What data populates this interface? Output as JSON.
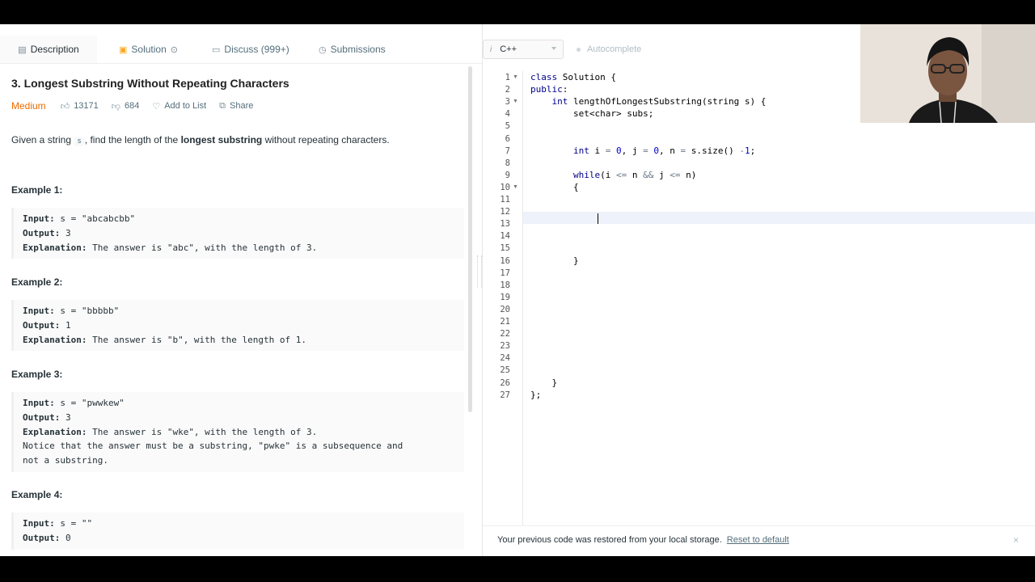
{
  "tabs": [
    {
      "label": "Description",
      "icon": "description-icon"
    },
    {
      "label": "Solution",
      "icon": "lock-icon"
    },
    {
      "label": "Discuss (999+)",
      "icon": "chat-icon"
    },
    {
      "label": "Submissions",
      "icon": "clock-icon"
    }
  ],
  "problem": {
    "title": "3. Longest Substring Without Repeating Characters",
    "difficulty": "Medium",
    "likes": "13171",
    "dislikes": "684",
    "add_to_list": "Add to List",
    "share": "Share",
    "statement_pre": "Given a string ",
    "statement_code": "s",
    "statement_mid": ", find the length of the ",
    "statement_bold": "longest substring",
    "statement_post": " without repeating characters."
  },
  "examples": [
    {
      "title": "Example 1:",
      "input_label": "Input:",
      "input": " s = \"abcabcbb\"",
      "output_label": "Output:",
      "output": " 3",
      "explanation_label": "Explanation:",
      "explanation": " The answer is \"abc\", with the length of 3."
    },
    {
      "title": "Example 2:",
      "input_label": "Input:",
      "input": " s = \"bbbbb\"",
      "output_label": "Output:",
      "output": " 1",
      "explanation_label": "Explanation:",
      "explanation": " The answer is \"b\", with the length of 1."
    },
    {
      "title": "Example 3:",
      "input_label": "Input:",
      "input": " s = \"pwwkew\"",
      "output_label": "Output:",
      "output": " 3",
      "explanation_label": "Explanation:",
      "explanation": " The answer is \"wke\", with the length of 3.",
      "note1": "Notice that the answer must be a substring, \"pwke\" is a subsequence and",
      "note2": "not a substring."
    },
    {
      "title": "Example 4:",
      "input_label": "Input:",
      "input": " s = \"\"",
      "output_label": "Output:",
      "output": " 0"
    }
  ],
  "editor": {
    "language": "C++",
    "language_info": "i",
    "autocomplete": "Autocomplete",
    "line_numbers": [
      "1",
      "2",
      "3",
      "4",
      "5",
      "6",
      "7",
      "8",
      "9",
      "10",
      "11",
      "12",
      "13",
      "14",
      "15",
      "16",
      "17",
      "18",
      "19",
      "20",
      "21",
      "22",
      "23",
      "24",
      "25",
      "26",
      "27"
    ],
    "code": {
      "l1_kw": "class",
      "l1_rest": " Solution {",
      "l2_kw": "public",
      "l2_rest": ":",
      "l3_ind": "    ",
      "l3_kw": "int",
      "l3_rest": " lengthOfLongestSubstring(string s) {",
      "l4": "        set<char> subs;",
      "l7_ind": "        ",
      "l7_kw": "int",
      "l7_a": " i ",
      "l7_eq1": "=",
      "l7_n0": " 0",
      "l7_b": ", j ",
      "l7_eq2": "=",
      "l7_n1": " 0",
      "l7_c": ", n ",
      "l7_eq3": "=",
      "l7_d": " s.size() ",
      "l7_minus": "-",
      "l7_n2": "1",
      "l7_e": ";",
      "l9_ind": "        ",
      "l9_kw": "while",
      "l9_a": "(i ",
      "l9_le1": "<=",
      "l9_b": " n ",
      "l9_and": "&&",
      "l9_c": " j ",
      "l9_le2": "<=",
      "l9_d": " n)",
      "l10": "        {",
      "l16": "        }",
      "l26": "    }",
      "l27": "};"
    }
  },
  "notice": {
    "message": "Your previous code was restored from your local storage.",
    "reset": "Reset to default",
    "close": "×"
  }
}
